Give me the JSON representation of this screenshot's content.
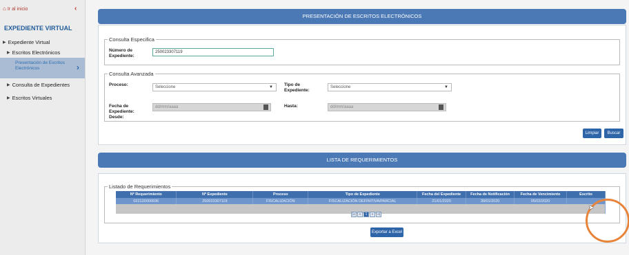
{
  "sidebar": {
    "home_label": "Ir al inicio",
    "collapse_icon": "‹",
    "title": "EXPEDIENTE VIRTUAL",
    "items": [
      {
        "label": "Expediente Virtual"
      },
      {
        "label": "Escritos Electrónicos"
      },
      {
        "label": "Presentación de Escritos Electrónicos"
      },
      {
        "label": "Consulta de Expedientes"
      },
      {
        "label": "Escritos Virtuales"
      }
    ]
  },
  "header": {
    "title": "PRESENTACIÓN DE ESCRITOS ELECTRÓNICOS"
  },
  "consulta_especifica": {
    "legend": "Consulta Especifica",
    "numero_label": "Número de Expediente:",
    "numero_value": "250023307119"
  },
  "consulta_avanzada": {
    "legend": "Consulta Avanzada",
    "proceso_label": "Proceso:",
    "proceso_value": "Seleccione",
    "tipo_label": "Tipo de Expediente:",
    "tipo_value": "Seleccione",
    "fecha_label": "Fecha de Expediente: Desde:",
    "fecha_placeholder": "dd/mm/aaaa",
    "hasta_label": "Hasta:",
    "hasta_placeholder": "dd/mm/aaaa"
  },
  "buttons": {
    "limpiar": "Limpiar",
    "buscar": "Buscar",
    "exportar": "Exportar a Excel"
  },
  "lista": {
    "title": "LISTA DE REQUERIMIENTOS",
    "legend": "Listado de Requerimientos",
    "columns": [
      "Nº Requerimiento",
      "Nº Expediente",
      "Proceso",
      "Tipo de Expediente",
      "Fecha del Expediente",
      "Fecha de Notificación",
      "Fecha de Vencimiento",
      "Escrito"
    ],
    "rows": [
      [
        "022120000936",
        "250023307119",
        "FISCALIZACIÓN",
        "FISCALIZACIÓN DEFINITIVA/PARCIAL",
        "21/01/2020",
        "30/01/2020",
        "05/02/2020",
        ""
      ]
    ],
    "pager": [
      "|«",
      "«",
      "1",
      "»",
      "»|"
    ]
  }
}
